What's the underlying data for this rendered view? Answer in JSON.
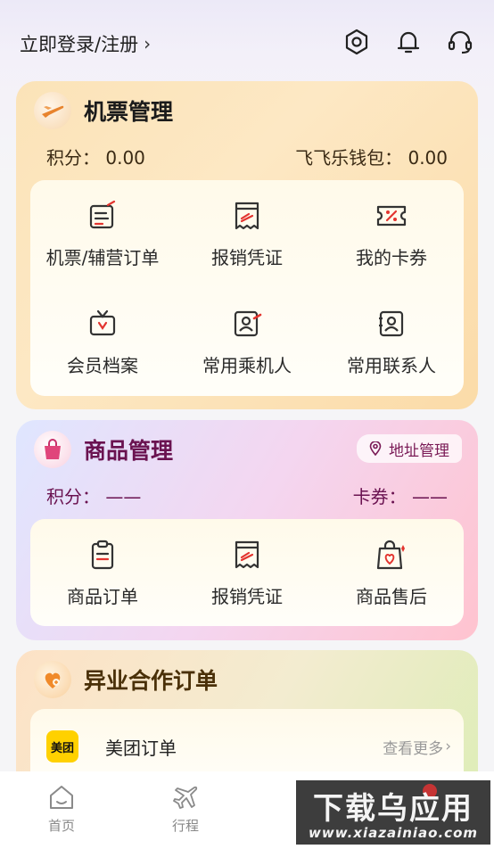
{
  "header": {
    "login_label": "立即登录/注册",
    "login_chevron": "›",
    "icons": [
      "settings-icon",
      "bell-icon",
      "headset-icon"
    ]
  },
  "flight": {
    "title": "机票管理",
    "points_label": "积分：",
    "points_value": "0.00",
    "wallet_label": "飞飞乐钱包：",
    "wallet_value": "0.00",
    "items": [
      {
        "label": "机票/辅营订单",
        "icon": "order-list-icon"
      },
      {
        "label": "报销凭证",
        "icon": "receipt-icon"
      },
      {
        "label": "我的卡券",
        "icon": "coupon-icon"
      },
      {
        "label": "会员档案",
        "icon": "member-tv-icon"
      },
      {
        "label": "常用乘机人",
        "icon": "passenger-id-icon"
      },
      {
        "label": "常用联系人",
        "icon": "contact-id-icon"
      }
    ]
  },
  "goods": {
    "title": "商品管理",
    "address_label": "地址管理",
    "points_label": "积分：",
    "points_value": "——",
    "coupon_label": "卡券：",
    "coupon_value": "——",
    "items": [
      {
        "label": "商品订单",
        "icon": "clipboard-icon"
      },
      {
        "label": "报销凭证",
        "icon": "receipt-icon"
      },
      {
        "label": "商品售后",
        "icon": "after-sales-bag-icon"
      }
    ]
  },
  "partner": {
    "title": "异业合作订单",
    "meituan_logo": "美团",
    "meituan_name": "美团订单",
    "more_label": "查看更多",
    "more_chevron": "›"
  },
  "tabbar": {
    "home_label": "首页",
    "trip_label": "行程"
  },
  "watermark": {
    "main": "下载乌应用",
    "sub": "www.xiazainiao.com"
  },
  "colors": {
    "accent_red": "#e3342f",
    "goods_title": "#6a1250",
    "icon_dark": "#333333"
  }
}
